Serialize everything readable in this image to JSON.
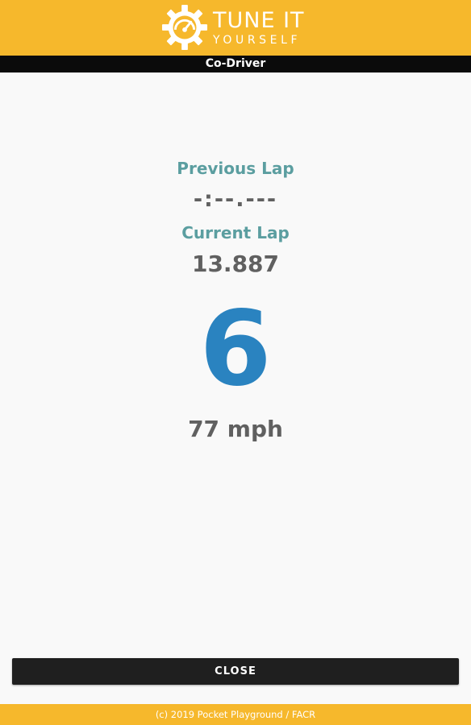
{
  "header": {
    "logo_line1": "TUNE IT",
    "logo_line2": "YOURSELF",
    "logo_icon": "gear-gauge-icon"
  },
  "subheader": {
    "title": "Co-Driver"
  },
  "lap": {
    "previous_label": "Previous Lap",
    "previous_value": "-:--.---",
    "current_label": "Current Lap",
    "current_value": "13.887"
  },
  "gear": {
    "value": "6"
  },
  "speed": {
    "value": "77 mph"
  },
  "buttons": {
    "close_label": "CLOSE"
  },
  "footer": {
    "copyright": "(c) 2019 Pocket Playground / FACR"
  },
  "colors": {
    "brand_yellow": "#f6b82c",
    "bar_black": "#0b0b0b",
    "label_teal": "#5b9ea0",
    "gear_blue": "#2a83c0",
    "value_gray": "#606060",
    "background": "#f9f9f9"
  }
}
